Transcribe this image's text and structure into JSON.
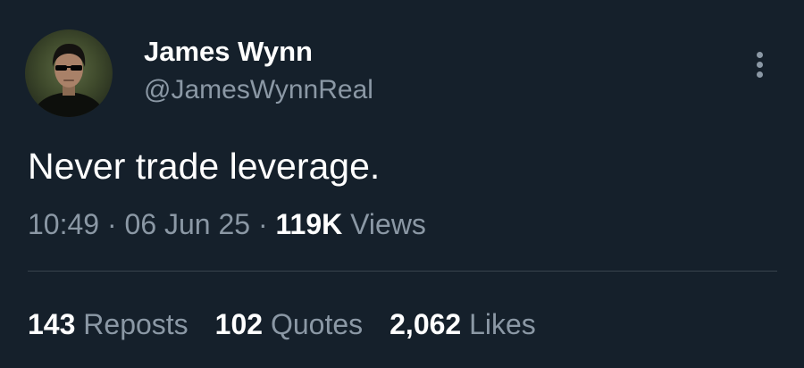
{
  "author": {
    "display_name": "James Wynn",
    "handle": "@JamesWynnReal"
  },
  "tweet": {
    "text": "Never trade leverage.",
    "time": "10:49",
    "date": "06 Jun 25",
    "views_count": "119K",
    "views_label": "Views",
    "separator": " · "
  },
  "stats": {
    "reposts_count": "143",
    "reposts_label": "Reposts",
    "quotes_count": "102",
    "quotes_label": "Quotes",
    "likes_count": "2,062",
    "likes_label": "Likes"
  },
  "icons": {
    "more": "more-vertical-icon"
  },
  "colors": {
    "background": "#15202b",
    "primary_text": "#ffffff",
    "secondary_text": "#8b98a5",
    "divider": "#38444d"
  }
}
